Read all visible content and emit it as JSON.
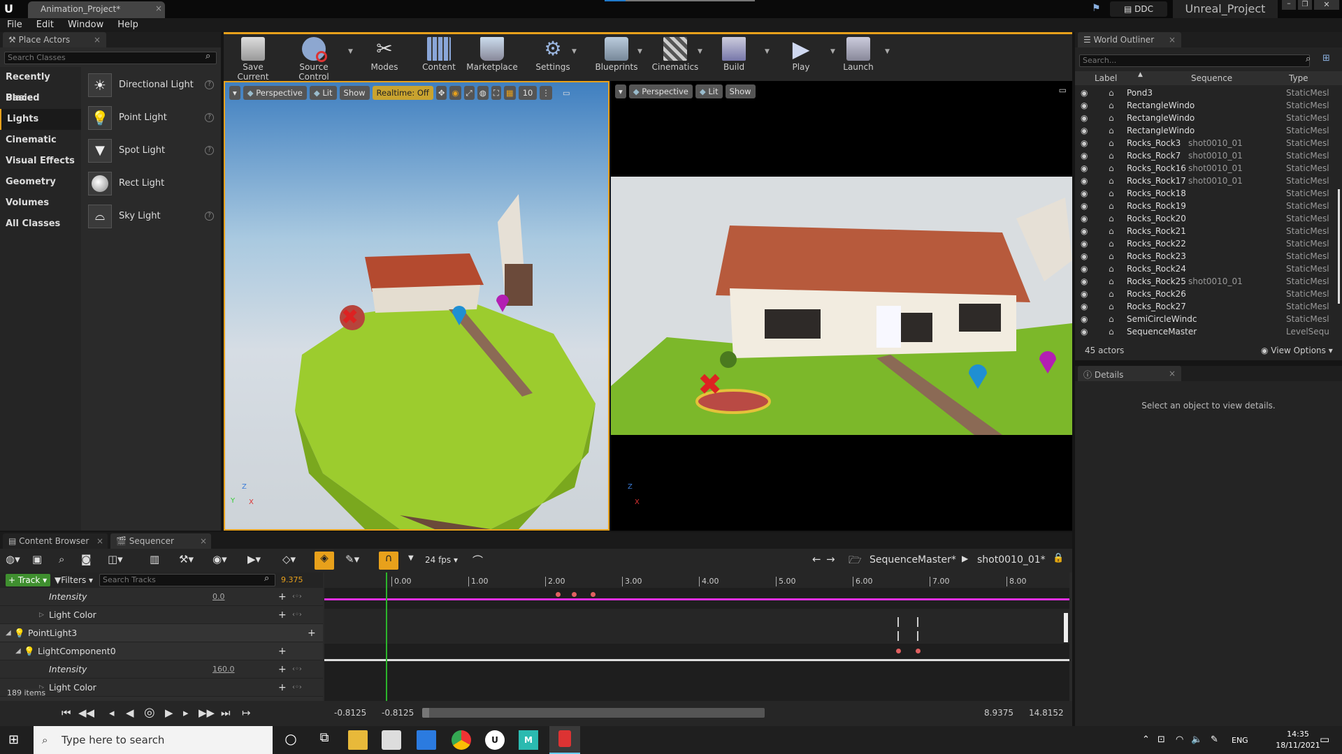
{
  "window": {
    "tab_title": "Animation_Project*",
    "ddc_label": "DDC",
    "project_name": "Unreal_Project"
  },
  "menu": [
    "File",
    "Edit",
    "Window",
    "Help"
  ],
  "place_actors": {
    "tab_label": "Place Actors",
    "search_placeholder": "Search Classes",
    "categories": [
      "Recently Placed",
      "Basic",
      "Lights",
      "Cinematic",
      "Visual Effects",
      "Geometry",
      "Volumes",
      "All Classes"
    ],
    "selected_category": "Lights",
    "items": [
      "Directional Light",
      "Point Light",
      "Spot Light",
      "Rect Light",
      "Sky Light"
    ]
  },
  "toolbar": {
    "buttons": [
      "Save Current",
      "Source Control",
      "Modes",
      "Content",
      "Marketplace",
      "Settings",
      "Blueprints",
      "Cinematics",
      "Build",
      "Play",
      "Launch"
    ]
  },
  "viewport_left": {
    "perspective": "Perspective",
    "lit": "Lit",
    "show": "Show",
    "realtime": "Realtime: Off",
    "grid_size": "10"
  },
  "viewport_right": {
    "perspective": "Perspective",
    "lit": "Lit",
    "show": "Show"
  },
  "outliner": {
    "tab_label": "World Outliner",
    "search_placeholder": "Search...",
    "columns": [
      "Label",
      "Sequence",
      "Type"
    ],
    "rows": [
      {
        "label": "Pond3",
        "sequence": "",
        "type": "StaticMesl"
      },
      {
        "label": "RectangleWindo",
        "sequence": "",
        "type": "StaticMesl"
      },
      {
        "label": "RectangleWindo",
        "sequence": "",
        "type": "StaticMesl"
      },
      {
        "label": "RectangleWindo",
        "sequence": "",
        "type": "StaticMesl"
      },
      {
        "label": "Rocks_Rock3",
        "sequence": "shot0010_01",
        "type": "StaticMesl"
      },
      {
        "label": "Rocks_Rock7",
        "sequence": "shot0010_01",
        "type": "StaticMesl"
      },
      {
        "label": "Rocks_Rock16",
        "sequence": "shot0010_01",
        "type": "StaticMesl"
      },
      {
        "label": "Rocks_Rock17",
        "sequence": "shot0010_01",
        "type": "StaticMesl"
      },
      {
        "label": "Rocks_Rock18",
        "sequence": "",
        "type": "StaticMesl"
      },
      {
        "label": "Rocks_Rock19",
        "sequence": "",
        "type": "StaticMesl"
      },
      {
        "label": "Rocks_Rock20",
        "sequence": "",
        "type": "StaticMesl"
      },
      {
        "label": "Rocks_Rock21",
        "sequence": "",
        "type": "StaticMesl"
      },
      {
        "label": "Rocks_Rock22",
        "sequence": "",
        "type": "StaticMesl"
      },
      {
        "label": "Rocks_Rock23",
        "sequence": "",
        "type": "StaticMesl"
      },
      {
        "label": "Rocks_Rock24",
        "sequence": "",
        "type": "StaticMesl"
      },
      {
        "label": "Rocks_Rock25",
        "sequence": "shot0010_01",
        "type": "StaticMesl"
      },
      {
        "label": "Rocks_Rock26",
        "sequence": "",
        "type": "StaticMesl"
      },
      {
        "label": "Rocks_Rock27",
        "sequence": "",
        "type": "StaticMesl"
      },
      {
        "label": "SemiCircleWindc",
        "sequence": "",
        "type": "StaticMesl"
      },
      {
        "label": "SequenceMaster",
        "sequence": "",
        "type": "LevelSequ"
      }
    ],
    "actor_count": "45 actors",
    "view_options": "View Options"
  },
  "details": {
    "tab_label": "Details",
    "empty_text": "Select an object to view details."
  },
  "bottom_tabs": [
    "Content Browser",
    "Sequencer"
  ],
  "sequencer": {
    "fps": "24 fps",
    "breadcrumb_master": "SequenceMaster*",
    "breadcrumb_shot": "shot0010_01*",
    "add_track": "Track",
    "filters": "Filters",
    "search_placeholder": "Search Tracks",
    "current_time": "9.375",
    "tracks": [
      {
        "name": "Intensity",
        "value": "0.0",
        "italic": true,
        "indent": 2
      },
      {
        "name": "Light Color",
        "value": "",
        "italic": false,
        "indent": 2
      },
      {
        "name": "PointLight3",
        "value": "",
        "italic": false,
        "indent": 0
      },
      {
        "name": "LightComponent0",
        "value": "",
        "italic": false,
        "indent": 1
      },
      {
        "name": "Intensity",
        "value": "160.0",
        "italic": true,
        "indent": 2
      },
      {
        "name": "Light Color",
        "value": "",
        "italic": false,
        "indent": 2
      }
    ],
    "item_count": "189 items",
    "ruler_labels": [
      "0.00",
      "1.00",
      "2.00",
      "3.00",
      "4.00",
      "5.00",
      "6.00",
      "7.00",
      "8.00"
    ],
    "range_start": "-0.8125",
    "view_start": "-0.8125",
    "view_end": "8.9375",
    "range_end": "14.8152"
  },
  "taskbar": {
    "search_placeholder": "Type here to search",
    "lang": "ENG",
    "time": "14:35",
    "date": "18/11/2021"
  }
}
